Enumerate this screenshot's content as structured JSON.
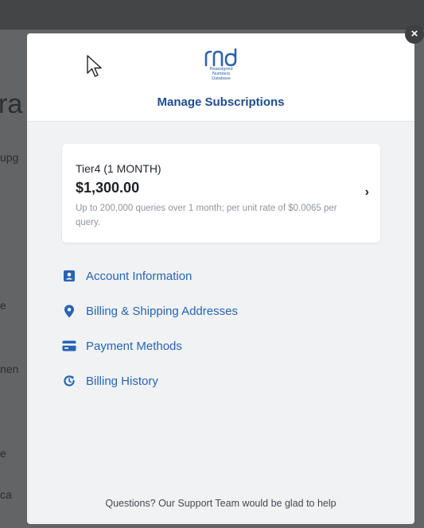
{
  "background": {
    "heading_fragment": "ra",
    "sub_fragment": "upg",
    "line1_fragment": "e",
    "line2_fragment": "nen",
    "line3_fragment": "e",
    "line4_fragment": "ca"
  },
  "modal": {
    "logo": {
      "mark": "rnd",
      "line1": "Reassigned",
      "line2": "Numbers",
      "line3": "Database"
    },
    "title": "Manage Subscriptions",
    "subscription": {
      "name": "Tier4 (1 MONTH)",
      "price": "$1,300.00",
      "description": "Up to 200,000 queries over 1 month; per unit rate of $0.0065 per query.",
      "chevron": "›"
    },
    "menu": [
      {
        "label": "Account Information",
        "icon": "id-card-icon"
      },
      {
        "label": "Billing & Shipping Addresses",
        "icon": "map-pin-icon"
      },
      {
        "label": "Payment Methods",
        "icon": "credit-card-icon"
      },
      {
        "label": "Billing History",
        "icon": "history-icon"
      }
    ],
    "support_text": "Questions? Our Support Team would be glad to help",
    "close_label": "×"
  },
  "colors": {
    "accent": "#2864b4",
    "title": "#1e4c8f",
    "overlay": "#626466"
  }
}
